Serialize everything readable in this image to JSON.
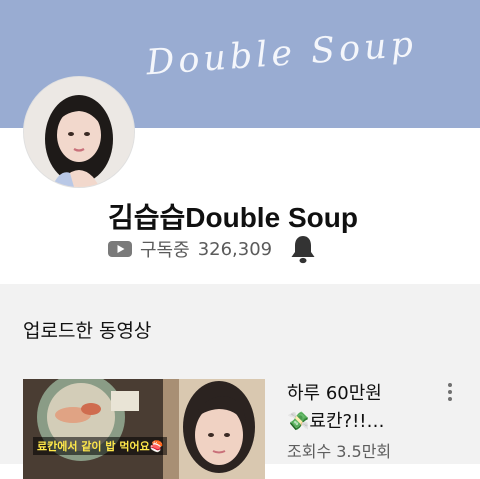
{
  "banner": {
    "text": "Double Soup",
    "color": "#99acd2"
  },
  "channel": {
    "name": "김습습Double Soup",
    "subscribe_label": "구독중",
    "subscriber_count": "326,309"
  },
  "section": {
    "title": "업로드한 동영상"
  },
  "video": {
    "title_line1": "하루 60만원",
    "title_line2": "💸료칸?!!…",
    "views": "조회수 3.5만회",
    "thumbnail_caption": "료칸에서 같이 밥 먹어요🍣"
  },
  "icons": {
    "subscribe": "youtube-icon",
    "notification": "bell-icon",
    "more": "more-vertical-icon"
  }
}
